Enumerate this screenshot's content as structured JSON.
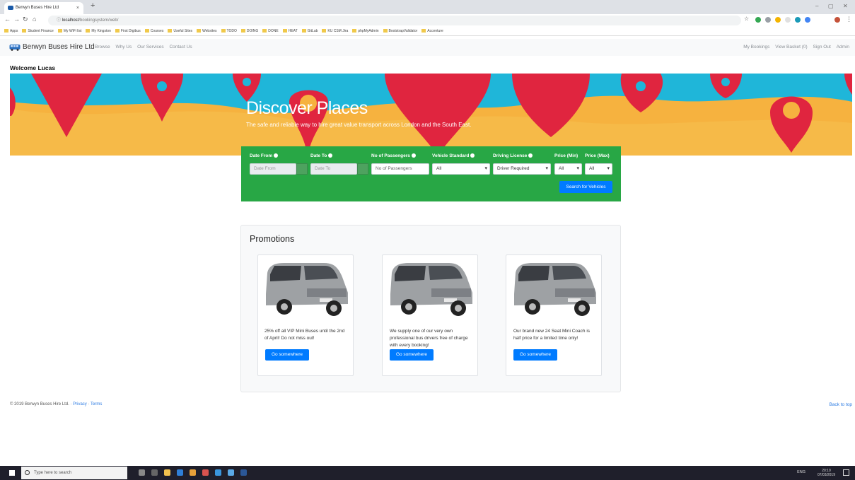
{
  "browser": {
    "tab_title": "Berwyn Buses Hire Ltd",
    "tab_close": "×",
    "new_tab": "+",
    "url_host": "localhost",
    "url_path": "/bookingsystem/web/",
    "bookmarks": [
      "Apps",
      "Student Finance",
      "My WiFi list",
      "My Kingston",
      "First Digibus",
      "Courses",
      "Useful Sites",
      "Websites",
      "TODO",
      "DOING",
      "DONE",
      "HEAT",
      "GitLab",
      "KU CSM Jira",
      "phpMyAdmin",
      "BootstrapValidator",
      "Accenture"
    ]
  },
  "nav": {
    "brand": "Berwyn Buses Hire Ltd",
    "links": [
      "Browse",
      "Why Us",
      "Our Services",
      "Contact Us"
    ],
    "right_links": [
      "My Bookings",
      "View Basket (0)",
      "Sign Out",
      "Admin"
    ]
  },
  "welcome": "Welcome Lucas",
  "hero": {
    "title": "Discover Places",
    "subtitle": "The safe and reliable way to hire great value transport across London and the South East."
  },
  "search": {
    "labels": {
      "date_from": "Date From",
      "date_to": "Date To",
      "passengers": "No of Passengers",
      "vehicle_standard": "Vehicle Standard",
      "driving_license": "Driving License",
      "price_min": "Price (Min)",
      "price_max": "Price (Max)"
    },
    "placeholders": {
      "date_from": "Date From",
      "date_to": "Date To",
      "passengers": "No of Passengers"
    },
    "values": {
      "vehicle_standard": "All",
      "driving_license": "Driver Required",
      "price_min": "All",
      "price_max": "All"
    },
    "submit": "Search for Vehicles"
  },
  "promotions": {
    "title": "Promotions",
    "cards": [
      {
        "text": "25% off all VIP Mini Buses until the 2nd of April! Do not miss out!",
        "button": "Go somewhere"
      },
      {
        "text": "We supply one of our very own professional bus drivers free of charge with every booking!",
        "button": "Go somewhere"
      },
      {
        "text": "Our brand new 24 Seat Mini Coach is half price for a limited time only!",
        "button": "Go somewhere"
      }
    ]
  },
  "footer": {
    "copyright": "© 2019 Berwyn Buses Hire Ltd. · ",
    "privacy": "Privacy",
    "sep": " · ",
    "terms": "Terms",
    "back_to_top": "Back to top"
  },
  "taskbar": {
    "search_placeholder": "Type here to search",
    "tray_lang": "ENG",
    "time": "20:10",
    "date": "07/03/2019"
  },
  "colors": {
    "search_panel": "#28a745",
    "primary": "#007bff",
    "hero_bg": "#f6b23f",
    "pin_red": "#e0253f",
    "sky": "#1fb6d9"
  }
}
